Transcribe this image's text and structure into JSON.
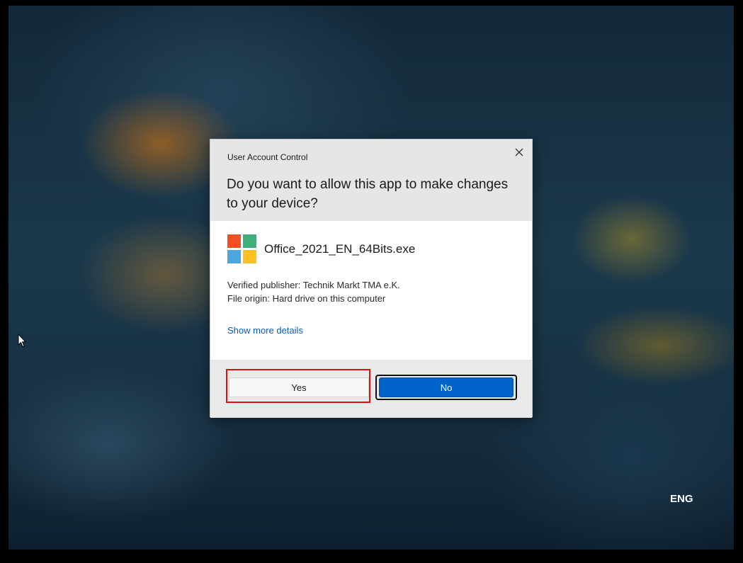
{
  "dialog": {
    "title": "User Account Control",
    "question": "Do you want to allow this app to make changes to your device?",
    "app_name": "Office_2021_EN_64Bits.exe",
    "publisher": "Verified publisher: Technik Markt TMA e.K.",
    "origin": "File origin: Hard drive on this computer",
    "more_details_label": "Show more details",
    "yes_label": "Yes",
    "no_label": "No",
    "close_icon": "close-icon"
  },
  "app_icon": {
    "name": "microsoft-logo-icon",
    "colors": [
      "#f25022",
      "#3fb07a",
      "#4aa7e0",
      "#ffc121"
    ]
  },
  "system": {
    "language": "ENG"
  },
  "colors": {
    "accent": "#0063c9",
    "link": "#0b5cad",
    "highlight": "#e01010"
  }
}
